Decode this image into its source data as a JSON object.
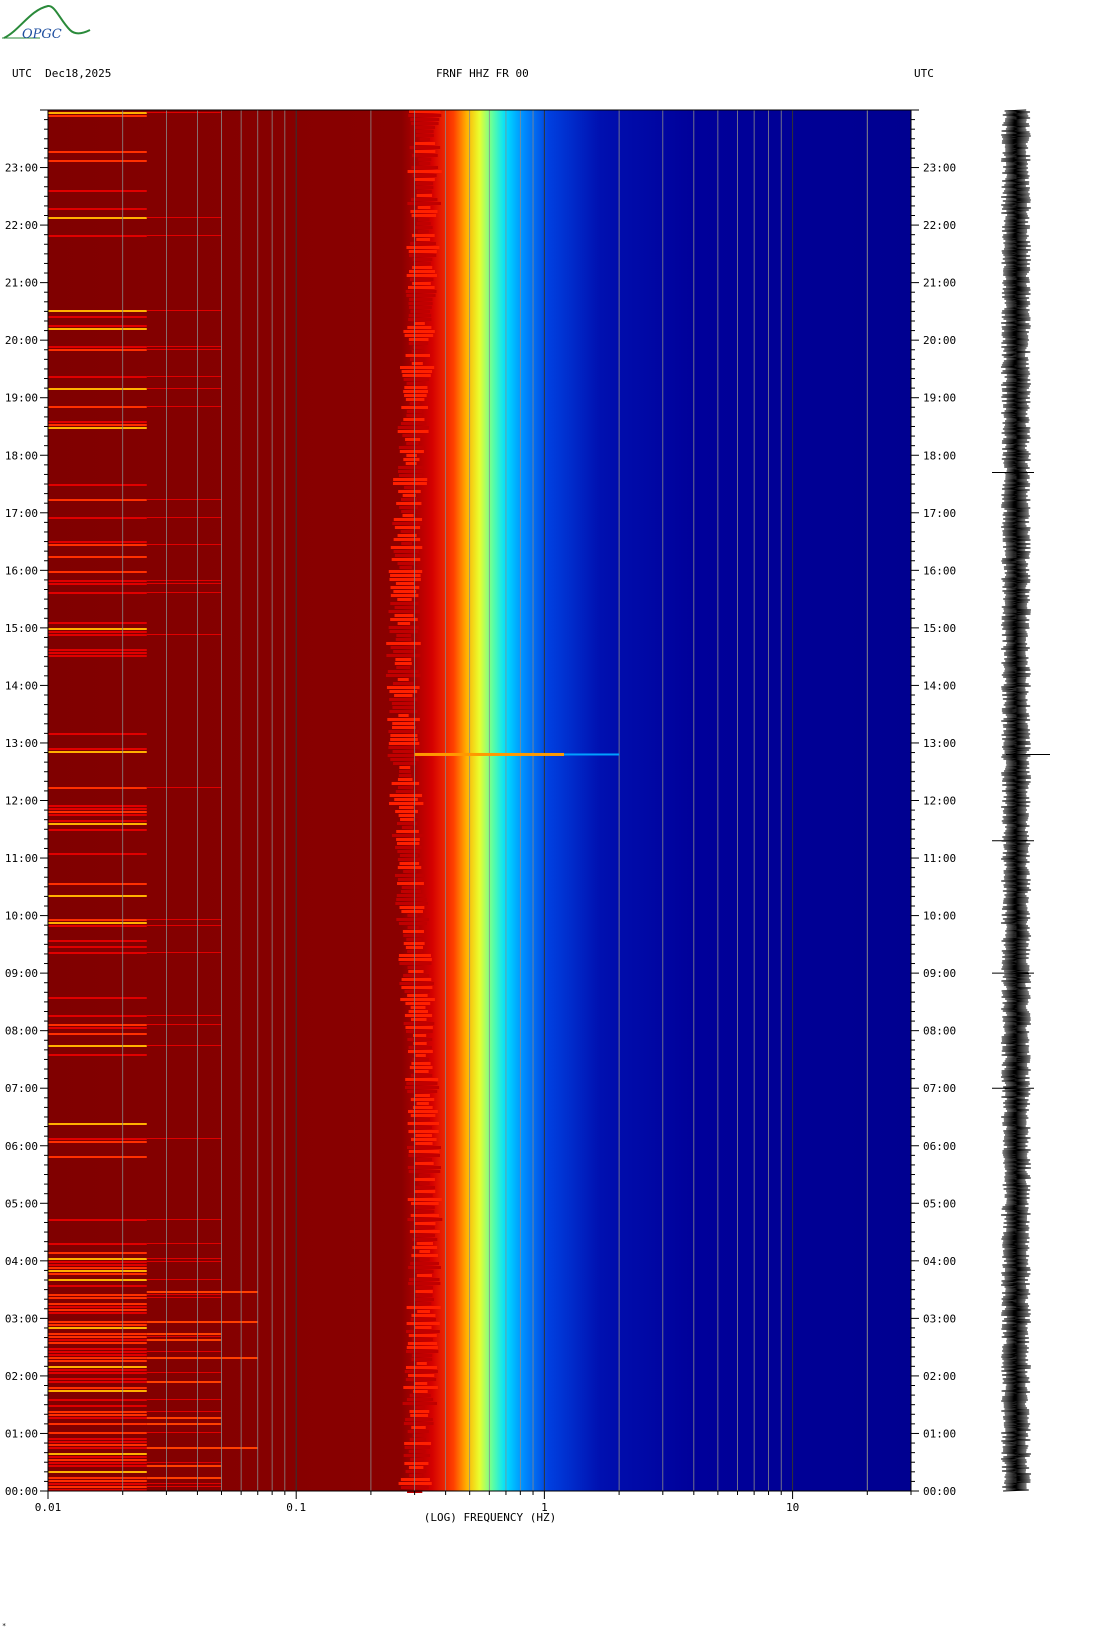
{
  "header": {
    "logo_text": "OPGC",
    "left_label": "UTC  Dec18,2025",
    "center_label": "FRNF HHZ FR 00",
    "right_label": "UTC"
  },
  "footer": {
    "corner_mark": "*"
  },
  "colors": {
    "background_low_freq": "#800000",
    "background_high_freq": "#00008f",
    "event_color": "#ff9900",
    "logo_color": "#2a8a3a"
  },
  "chart_data": {
    "type": "heatmap",
    "title": "FRNF HHZ FR 00",
    "xlabel": "(LOG) FREQUENCY (HZ)",
    "x_scale": "log",
    "xlim": [
      0.01,
      30
    ],
    "x_tick_labels": [
      {
        "value": 0.01,
        "label": "0.01"
      },
      {
        "value": 0.1,
        "label": "0.1"
      },
      {
        "value": 1,
        "label": "1"
      },
      {
        "value": 10,
        "label": "10"
      }
    ],
    "y_unit": "UTC hour",
    "ylim": [
      0,
      24
    ],
    "y_tick_labels": [
      "00:00",
      "01:00",
      "02:00",
      "03:00",
      "04:00",
      "05:00",
      "06:00",
      "07:00",
      "08:00",
      "09:00",
      "10:00",
      "11:00",
      "12:00",
      "13:00",
      "14:00",
      "15:00",
      "16:00",
      "17:00",
      "18:00",
      "19:00",
      "20:00",
      "21:00",
      "22:00",
      "23:00"
    ],
    "colormap": "jet",
    "spectral_boundary_hz": {
      "red_to_yellow": 0.35,
      "cyan": 0.45,
      "to_blue": 0.6
    },
    "notable_events": [
      {
        "time_utc": "12:48",
        "max_freq_hz": 2.0
      }
    ],
    "seismogram_trace": "right"
  }
}
